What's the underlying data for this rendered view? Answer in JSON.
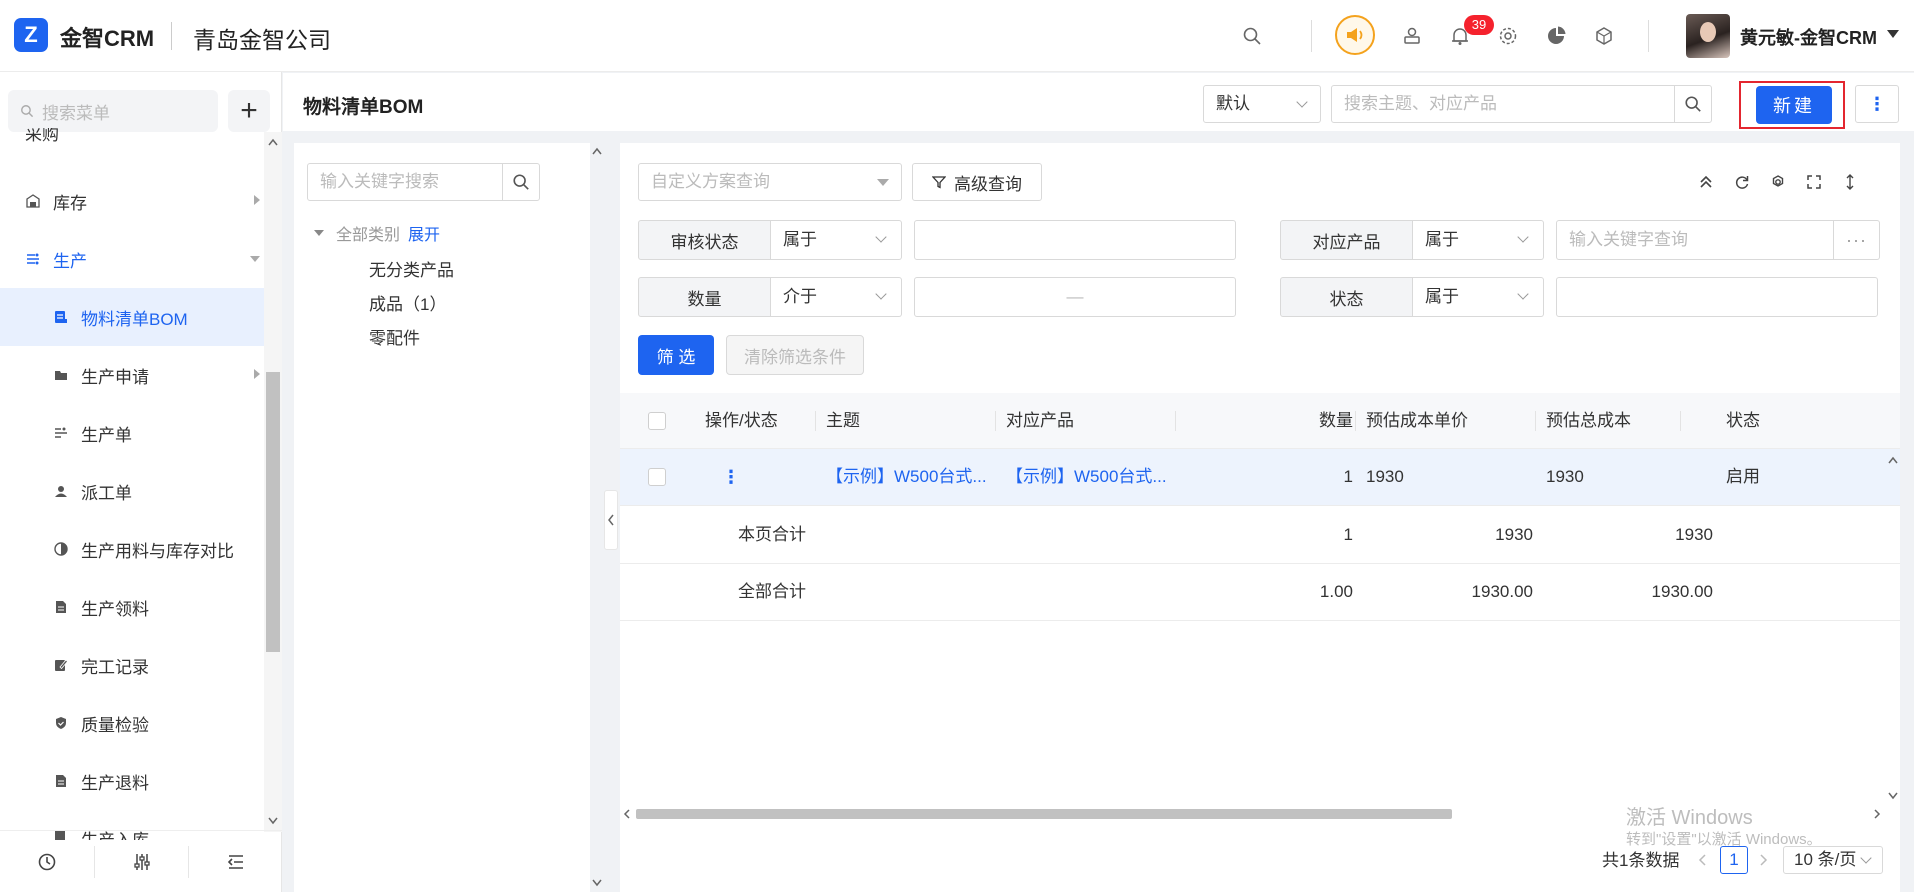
{
  "header": {
    "brand": "金智CRM",
    "company": "青岛金智公司",
    "notification_count": "39",
    "user_name": "黄元敏-金智CRM"
  },
  "sidebar": {
    "search_placeholder": "搜索菜单",
    "partial_item": "采购",
    "items": [
      {
        "label": "库存",
        "icon": "warehouse-icon"
      },
      {
        "label": "生产",
        "icon": "production-icon"
      },
      {
        "label": "物料清单BOM",
        "icon": "bom-icon"
      },
      {
        "label": "生产申请",
        "icon": "folder-icon"
      },
      {
        "label": "生产单",
        "icon": "order-icon"
      },
      {
        "label": "派工单",
        "icon": "worker-icon"
      },
      {
        "label": "生产用料与库存对比",
        "icon": "compare-icon"
      },
      {
        "label": "生产领料",
        "icon": "document-icon"
      },
      {
        "label": "完工记录",
        "icon": "edit-record-icon"
      },
      {
        "label": "质量检验",
        "icon": "shield-icon"
      },
      {
        "label": "生产退料",
        "icon": "document-icon"
      },
      {
        "label": "生产入库",
        "icon": "inbound-icon"
      }
    ]
  },
  "page": {
    "title": "物料清单BOM",
    "view_select": "默认",
    "search_placeholder": "搜索主题、对应产品",
    "new_button": "新建"
  },
  "tree": {
    "search_placeholder": "输入关键字搜索",
    "root_label": "全部类别",
    "expand_label": "展开",
    "nodes": [
      "无分类产品",
      "成品（1）",
      "零配件"
    ]
  },
  "filters": {
    "scheme_placeholder": "自定义方案查询",
    "advanced_label": "高级查询",
    "rows": [
      {
        "label": "审核状态",
        "op": "属于",
        "value": ""
      },
      {
        "label": "对应产品",
        "op": "属于",
        "value_placeholder": "输入关键字查询"
      },
      {
        "label": "数量",
        "op": "介于",
        "range_sep": "—"
      },
      {
        "label": "状态",
        "op": "属于",
        "value": ""
      }
    ],
    "filter_button": "筛 选",
    "clear_button": "清除筛选条件"
  },
  "table": {
    "columns": [
      "操作/状态",
      "主题",
      "对应产品",
      "数量",
      "预估成本单价",
      "预估总成本",
      "状态"
    ],
    "rows": [
      {
        "subject": "【示例】W500台式...",
        "product": "【示例】W500台式...",
        "qty": "1",
        "unit_cost": "1930",
        "total_cost": "1930",
        "status": "启用"
      }
    ],
    "page_total": {
      "label": "本页合计",
      "qty": "1",
      "unit_cost": "1930",
      "total_cost": "1930"
    },
    "all_total": {
      "label": "全部合计",
      "qty": "1.00",
      "unit_cost": "1930.00",
      "total_cost": "1930.00"
    }
  },
  "pagination": {
    "total_text": "共1条数据",
    "current_page": "1",
    "page_size": "10 条/页"
  },
  "watermark": {
    "line1": "激活 Windows",
    "line2": "转到\"设置\"以激活 Windows。"
  },
  "colors": {
    "primary": "#1e64f0",
    "highlight_border": "#e3262f",
    "badge": "#f5222d",
    "speaker": "#f4a21d"
  }
}
